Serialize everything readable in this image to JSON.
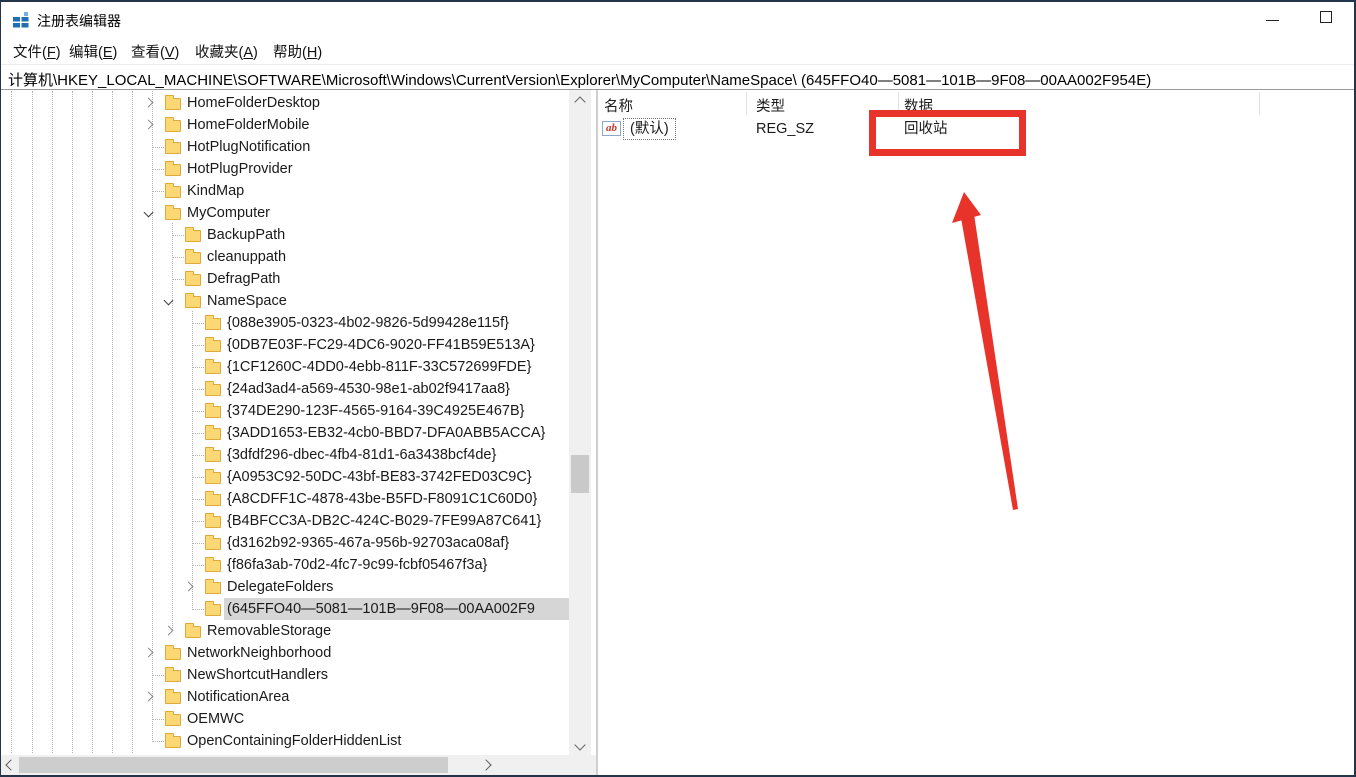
{
  "window": {
    "title": "注册表编辑器"
  },
  "menu": {
    "items": [
      {
        "label": "文件",
        "mnemonic": "F"
      },
      {
        "label": "编辑",
        "mnemonic": "E"
      },
      {
        "label": "查看",
        "mnemonic": "V"
      },
      {
        "label": "收藏夹",
        "mnemonic": "A"
      },
      {
        "label": "帮助",
        "mnemonic": "H"
      }
    ]
  },
  "address": {
    "path": "计算机\\HKEY_LOCAL_MACHINE\\SOFTWARE\\Microsoft\\Windows\\CurrentVersion\\Explorer\\MyComputer\\NameSpace\\ (645FFO40—5081—101B—9F08—00AA002F954E)"
  },
  "tree": {
    "items": [
      {
        "label": "HomeFolderDesktop",
        "level": 0,
        "chevron": "collapsed",
        "selected": false
      },
      {
        "label": "HomeFolderMobile",
        "level": 0,
        "chevron": "collapsed",
        "selected": false
      },
      {
        "label": "HotPlugNotification",
        "level": 0,
        "chevron": "none",
        "selected": false
      },
      {
        "label": "HotPlugProvider",
        "level": 0,
        "chevron": "none",
        "selected": false
      },
      {
        "label": "KindMap",
        "level": 0,
        "chevron": "none",
        "selected": false
      },
      {
        "label": "MyComputer",
        "level": 0,
        "chevron": "expanded",
        "selected": false
      },
      {
        "label": "BackupPath",
        "level": 1,
        "chevron": "none",
        "selected": false
      },
      {
        "label": "cleanuppath",
        "level": 1,
        "chevron": "none",
        "selected": false
      },
      {
        "label": "DefragPath",
        "level": 1,
        "chevron": "none",
        "selected": false
      },
      {
        "label": "NameSpace",
        "level": 1,
        "chevron": "expanded",
        "selected": false
      },
      {
        "label": "{088e3905-0323-4b02-9826-5d99428e115f}",
        "level": 2,
        "chevron": "none",
        "selected": false
      },
      {
        "label": "{0DB7E03F-FC29-4DC6-9020-FF41B59E513A}",
        "level": 2,
        "chevron": "none",
        "selected": false
      },
      {
        "label": "{1CF1260C-4DD0-4ebb-811F-33C572699FDE}",
        "level": 2,
        "chevron": "none",
        "selected": false
      },
      {
        "label": "{24ad3ad4-a569-4530-98e1-ab02f9417aa8}",
        "level": 2,
        "chevron": "none",
        "selected": false
      },
      {
        "label": "{374DE290-123F-4565-9164-39C4925E467B}",
        "level": 2,
        "chevron": "none",
        "selected": false
      },
      {
        "label": "{3ADD1653-EB32-4cb0-BBD7-DFA0ABB5ACCA}",
        "level": 2,
        "chevron": "none",
        "selected": false
      },
      {
        "label": "{3dfdf296-dbec-4fb4-81d1-6a3438bcf4de}",
        "level": 2,
        "chevron": "none",
        "selected": false
      },
      {
        "label": "{A0953C92-50DC-43bf-BE83-3742FED03C9C}",
        "level": 2,
        "chevron": "none",
        "selected": false
      },
      {
        "label": "{A8CDFF1C-4878-43be-B5FD-F8091C1C60D0}",
        "level": 2,
        "chevron": "none",
        "selected": false
      },
      {
        "label": "{B4BFCC3A-DB2C-424C-B029-7FE99A87C641}",
        "level": 2,
        "chevron": "none",
        "selected": false
      },
      {
        "label": "{d3162b92-9365-467a-956b-92703aca08af}",
        "level": 2,
        "chevron": "none",
        "selected": false
      },
      {
        "label": "{f86fa3ab-70d2-4fc7-9c99-fcbf05467f3a}",
        "level": 2,
        "chevron": "none",
        "selected": false
      },
      {
        "label": "DelegateFolders",
        "level": 2,
        "chevron": "collapsed",
        "selected": false
      },
      {
        "label": "(645FFO40—5081—101B—9F08—00AA002F9",
        "level": 2,
        "chevron": "none",
        "selected": true
      },
      {
        "label": "RemovableStorage",
        "level": 1,
        "chevron": "collapsed",
        "selected": false
      },
      {
        "label": "NetworkNeighborhood",
        "level": 0,
        "chevron": "collapsed",
        "selected": false
      },
      {
        "label": "NewShortcutHandlers",
        "level": 0,
        "chevron": "none",
        "selected": false
      },
      {
        "label": "NotificationArea",
        "level": 0,
        "chevron": "collapsed",
        "selected": false
      },
      {
        "label": "OEMWC",
        "level": 0,
        "chevron": "none",
        "selected": false
      },
      {
        "label": "OpenContainingFolderHiddenList",
        "level": 0,
        "chevron": "none",
        "selected": false
      }
    ]
  },
  "list": {
    "columns": [
      "名称",
      "类型",
      "数据"
    ],
    "rows": [
      {
        "icon": "string-value-icon",
        "icon_glyph": "ab",
        "name": "(默认)",
        "type": "REG_SZ",
        "data": "回收站"
      }
    ]
  },
  "annotations": {
    "color": "#e8332a",
    "box_target": "回收站",
    "selection_bg": "#d6d6d6"
  }
}
